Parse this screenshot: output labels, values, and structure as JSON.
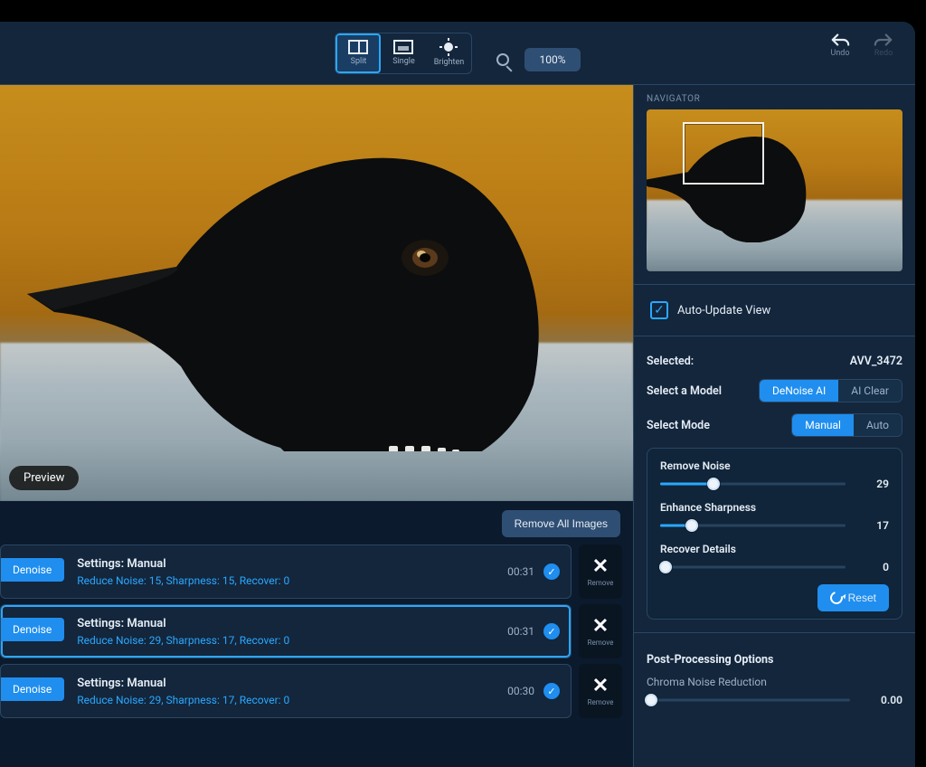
{
  "topbar": {
    "modes": {
      "split": "Split",
      "single": "Single",
      "brighten": "Brighten"
    },
    "zoom": "100%",
    "undo": "Undo",
    "redo": "Redo"
  },
  "preview": {
    "label": "Preview"
  },
  "actions": {
    "removeAll": "Remove All Images"
  },
  "queue": [
    {
      "chip": "Denoise",
      "title": "Settings: Manual",
      "sub": "Reduce Noise: 15, Sharpness: 15, Recover: 0",
      "time": "00:31",
      "remove": "Remove",
      "selected": false
    },
    {
      "chip": "Denoise",
      "title": "Settings: Manual",
      "sub": "Reduce Noise: 29, Sharpness: 17, Recover: 0",
      "time": "00:31",
      "remove": "Remove",
      "selected": true
    },
    {
      "chip": "Denoise",
      "title": "Settings: Manual",
      "sub": "Reduce Noise: 29, Sharpness: 17, Recover: 0",
      "time": "00:30",
      "remove": "Remove",
      "selected": false
    }
  ],
  "right": {
    "navigator": "NAVIGATOR",
    "autoUpdate": "Auto-Update View",
    "selectedLabel": "Selected:",
    "selectedValue": "AVV_3472",
    "selectModelLabel": "Select a Model",
    "models": {
      "a": "DeNoise AI",
      "b": "AI Clear"
    },
    "selectModeLabel": "Select Mode",
    "modes": {
      "manual": "Manual",
      "auto": "Auto"
    },
    "sliders": {
      "removeNoise": {
        "label": "Remove Noise",
        "value": 29,
        "max": 100
      },
      "enhanceSharpness": {
        "label": "Enhance Sharpness",
        "value": 17,
        "max": 100
      },
      "recoverDetails": {
        "label": "Recover Details",
        "value": 0,
        "max": 100
      }
    },
    "reset": "Reset",
    "postProcessing": "Post-Processing Options",
    "chroma": {
      "label": "Chroma Noise Reduction",
      "value": "0.00",
      "pct": 2
    }
  }
}
